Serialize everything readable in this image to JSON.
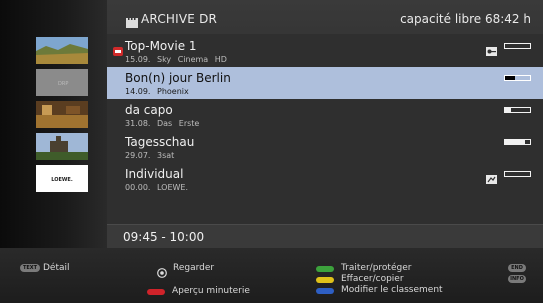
{
  "header": {
    "title": "ARCHIVE DR",
    "free_space": "capacité libre 68:42 h"
  },
  "recordings": [
    {
      "title": "Top-Movie 1",
      "subtitle": "15.09. Sky Cinema HD",
      "locked": true,
      "progress": 0.0,
      "selected": false
    },
    {
      "title": "Bon(n) jour Berlin",
      "subtitle": "14.09. Phoenix",
      "locked": false,
      "progress": 0.4,
      "selected": true
    },
    {
      "title": "da capo",
      "subtitle": "31.08. Das Erste",
      "locked": false,
      "progress": 0.25,
      "selected": false
    },
    {
      "title": "Tagesschau",
      "subtitle": "29.07. 3sat",
      "locked": false,
      "progress": 0.78,
      "selected": false
    },
    {
      "title": "Individual",
      "subtitle": "00.00. LOEWE.",
      "locked": false,
      "progress": 0.0,
      "selected": false
    }
  ],
  "thumbnails": [
    {
      "icon": "landscape-thumbnail"
    },
    {
      "icon": "broadcast-thumbnail",
      "label": "DRP"
    },
    {
      "icon": "stage-thumbnail"
    },
    {
      "icon": "castle-thumbnail"
    },
    {
      "icon": "logo-thumbnail",
      "label": "LOEWE."
    }
  ],
  "time_range": "09:45 - 10:00",
  "footer": {
    "text_badge": "TEXT",
    "detail": "Détail",
    "watch": "Regarder",
    "timer_preview": "Aperçu minuterie",
    "edit_protect": "Traiter/protéger",
    "delete_copy": "Effacer/copier",
    "sort": "Modifier le classement",
    "end_badge": "END",
    "info_badge": "INFO"
  },
  "colors": {
    "selected_row": "#aebfdc",
    "red_key": "#d0232a",
    "green_key": "#3ca23c",
    "yellow_key": "#e0c21a",
    "blue_key": "#2e5fc4"
  }
}
